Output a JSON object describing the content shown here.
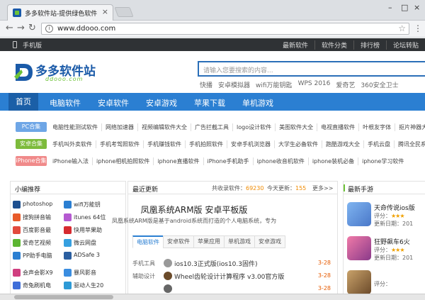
{
  "browser": {
    "tab_title": "多多软件站-提供绿色软件",
    "url": "www.ddooo.com"
  },
  "topbar": {
    "mobile": "手机版",
    "links": [
      "最新软件",
      "软件分类",
      "排行榜",
      "论坛转贴"
    ]
  },
  "header": {
    "logo_text": "多多软件站",
    "logo_sub": "ddooo.com",
    "search_placeholder": "请输入您要搜索的内容...",
    "hotwords": [
      "快播",
      "安卓模拟器",
      "wifi万能钥匙",
      "WPS 2016",
      "爱奇艺",
      "360安全卫士"
    ]
  },
  "mainnav": [
    "首页",
    "电脑软件",
    "安卓软件",
    "安卓游戏",
    "苹果下载",
    "单机游戏"
  ],
  "categories": [
    {
      "tag": "PC合集",
      "color": "#6ea6e6",
      "items": [
        "电脑性能测试软件",
        "网络加速器",
        "视频编辑软件大全",
        "广告拦截工具",
        "logo设计软件",
        "美图软件大全",
        "电视直播软件",
        "叶根友字体",
        "抠片神器大全"
      ]
    },
    {
      "tag": "安卓合集",
      "color": "#7dbb3c",
      "items": [
        "手机叫外卖软件",
        "手机考驾照软件",
        "手机赚钱软件",
        "手机拍照软件",
        "安卓手机浏览器",
        "大学生必备软件",
        "跑酷游戏大全",
        "手机云盘",
        "腾讯全民系列游戏"
      ]
    },
    {
      "tag": "iPhone合集",
      "color": "#f08a8a",
      "items": [
        "iPhone输入法",
        "iphone相机拍照软件",
        "iphone直播软件",
        "iPhone手机助手",
        "iphone收音机软件",
        "iphone装机必备",
        "iphone学习软件"
      ]
    }
  ],
  "editor_pick": {
    "title": "小编推荐",
    "items": [
      {
        "name": "photoshop",
        "color": "#1d4f8f"
      },
      {
        "name": "wifi万能钥",
        "color": "#2b7fd2"
      },
      {
        "name": "搜狗拼音输",
        "color": "#e85b2a"
      },
      {
        "name": "itunes 64位",
        "color": "#b55ad1"
      },
      {
        "name": "百度影音最",
        "color": "#e24a3d"
      },
      {
        "name": "快用苹果助",
        "color": "#d62b30"
      },
      {
        "name": "爱奇艺视频",
        "color": "#5cb531"
      },
      {
        "name": "微云网盘",
        "color": "#36a0e0"
      },
      {
        "name": "PP助手电脑",
        "color": "#2b7fd2"
      },
      {
        "name": "ADSafe 3",
        "color": "#2b5fa0"
      },
      {
        "name": "会声会影X9",
        "color": "#d03e7f"
      },
      {
        "name": "暴风影音",
        "color": "#3a8de0"
      },
      {
        "name": "奇兔刷机电",
        "color": "#3e6ed9"
      },
      {
        "name": "驱动人生20",
        "color": "#2d9ad6"
      }
    ]
  },
  "latest": {
    "title": "最近更新",
    "total_label": "共收录软件：",
    "total": "69230",
    "today_label": "今天更新：",
    "today": "155",
    "more": "更多>>",
    "feature_title": "凤凰系统ARM版 安卓平板版",
    "feature_desc": "凤凰系统ARM版是基于android系统而打造的个人电脑系统，专为",
    "tabs": [
      "电脑软件",
      "安卓软件",
      "苹果应用",
      "单机游戏",
      "安卓游戏"
    ],
    "rows": [
      {
        "cat": "手机工具",
        "name": "ios10.3正式版(ios10.3固件)",
        "date": "3-28",
        "color": "#999999"
      },
      {
        "cat": "辅助设计",
        "name": "Wheel齿轮设计计算程序 v3.00官方版",
        "date": "3-28",
        "color": "#6b4b2a"
      },
      {
        "cat": "",
        "name": "",
        "date": "3-28",
        "color": "#666666"
      }
    ]
  },
  "newgames": {
    "title": "最新手游",
    "items": [
      {
        "name": "天命传说ios版",
        "rate_label": "评分：",
        "stars": "★★★",
        "update_label": "更新日期：",
        "date": "201",
        "color": "#6aa0e8"
      },
      {
        "name": "狂野飙车6火",
        "rate_label": "评分：",
        "stars": "★★★",
        "update_label": "更新日期：",
        "date": "201",
        "color": "#d04a7a"
      },
      {
        "name": "",
        "rate_label": "评分：",
        "stars": "",
        "update_label": "",
        "date": "",
        "color": "#8a6a3a"
      }
    ]
  }
}
